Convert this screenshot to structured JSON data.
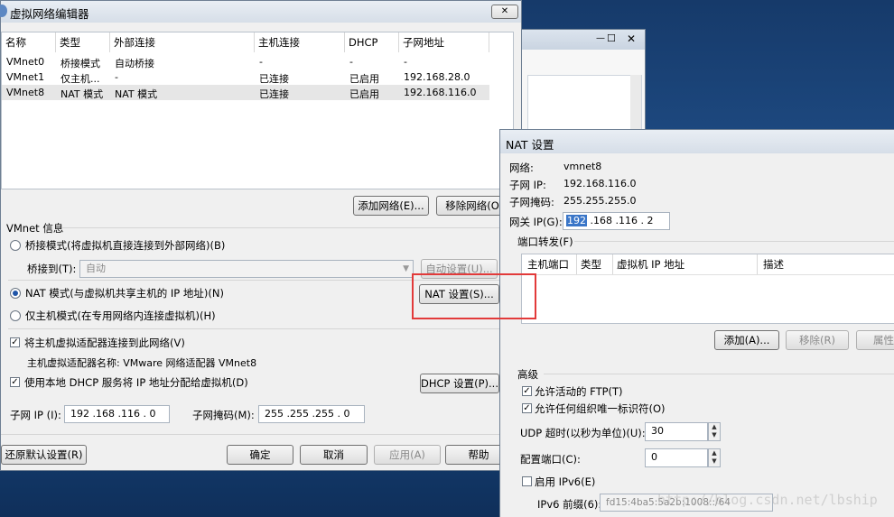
{
  "vne": {
    "title": "虚拟网络编辑器",
    "close_glyph": "✕",
    "table": {
      "headers": [
        "名称",
        "类型",
        "外部连接",
        "主机连接",
        "DHCP",
        "子网地址"
      ],
      "rows": [
        [
          "VMnet0",
          "桥接模式",
          "自动桥接",
          "-",
          "-",
          "-"
        ],
        [
          "VMnet1",
          "仅主机...",
          "-",
          "已连接",
          "已启用",
          "192.168.28.0"
        ],
        [
          "VMnet8",
          "NAT 模式",
          "NAT 模式",
          "已连接",
          "已启用",
          "192.168.116.0"
        ]
      ]
    },
    "add_network_btn": "添加网络(E)...",
    "remove_network_btn": "移除网络(O",
    "info_label": "VMnet 信息",
    "bridge_mode": "桥接模式(将虚拟机直接连接到外部网络)(B)",
    "bridge_to_label": "桥接到(T):",
    "bridge_to_value": "自动",
    "auto_settings_btn": "自动设置(U)...",
    "nat_mode": "NAT 模式(与虚拟机共享主机的 IP 地址)(N)",
    "nat_settings_btn": "NAT 设置(S)...",
    "hostonly_mode": "仅主机模式(在专用网络内连接虚拟机)(H)",
    "connect_adapter": "将主机虚拟适配器连接到此网络(V)",
    "adapter_name": "主机虚拟适配器名称: VMware 网络适配器 VMnet8",
    "use_dhcp": "使用本地 DHCP 服务将 IP 地址分配给虚拟机(D)",
    "dhcp_settings_btn": "DHCP 设置(P)...",
    "subnet_ip_label": "子网 IP (I):",
    "subnet_ip_value": "192 .168 .116 . 0",
    "subnet_mask_label": "子网掩码(M):",
    "subnet_mask_value": "255 .255 .255 . 0",
    "restore_btn": "还原默认设置(R)",
    "ok_btn": "确定",
    "cancel_btn": "取消",
    "apply_btn": "应用(A)",
    "help_btn": "帮助"
  },
  "bg": {
    "controls": [
      "—",
      "☐",
      "✕"
    ]
  },
  "nat": {
    "title": "NAT 设置",
    "network_label": "网络:",
    "network_value": "vmnet8",
    "subnet_ip_label": "子网 IP:",
    "subnet_ip_value": "192.168.116.0",
    "subnet_mask_label": "子网掩码:",
    "subnet_mask_value": "255.255.255.0",
    "gateway_label": "网关 IP(G):",
    "gateway_seg1": "192",
    "gateway_rest": ".168 .116 . 2",
    "port_forward_label": "端口转发(F)",
    "pf_headers": [
      "主机端口",
      "类型",
      "虚拟机 IP 地址",
      "描述"
    ],
    "add_btn": "添加(A)...",
    "remove_btn": "移除(R)",
    "props_btn": "属性",
    "advanced_label": "高级",
    "allow_ftp": "允许活动的 FTP(T)",
    "allow_oui": "允许任何组织唯一标识符(O)",
    "udp_timeout_label": "UDP 超时(以秒为单位)(U):",
    "udp_timeout_value": "30",
    "config_port_label": "配置端口(C):",
    "config_port_value": "0",
    "enable_ipv6": "启用 IPv6(E)",
    "ipv6_prefix_label": "IPv6 前缀(6):",
    "ipv6_prefix_value": "fd15:4ba5:5a2b:1008::/64"
  },
  "watermark": "http://blog.csdn.net/lbship",
  "colors": {
    "highlight": "#e23a3a",
    "selection": "#3a76c8"
  }
}
